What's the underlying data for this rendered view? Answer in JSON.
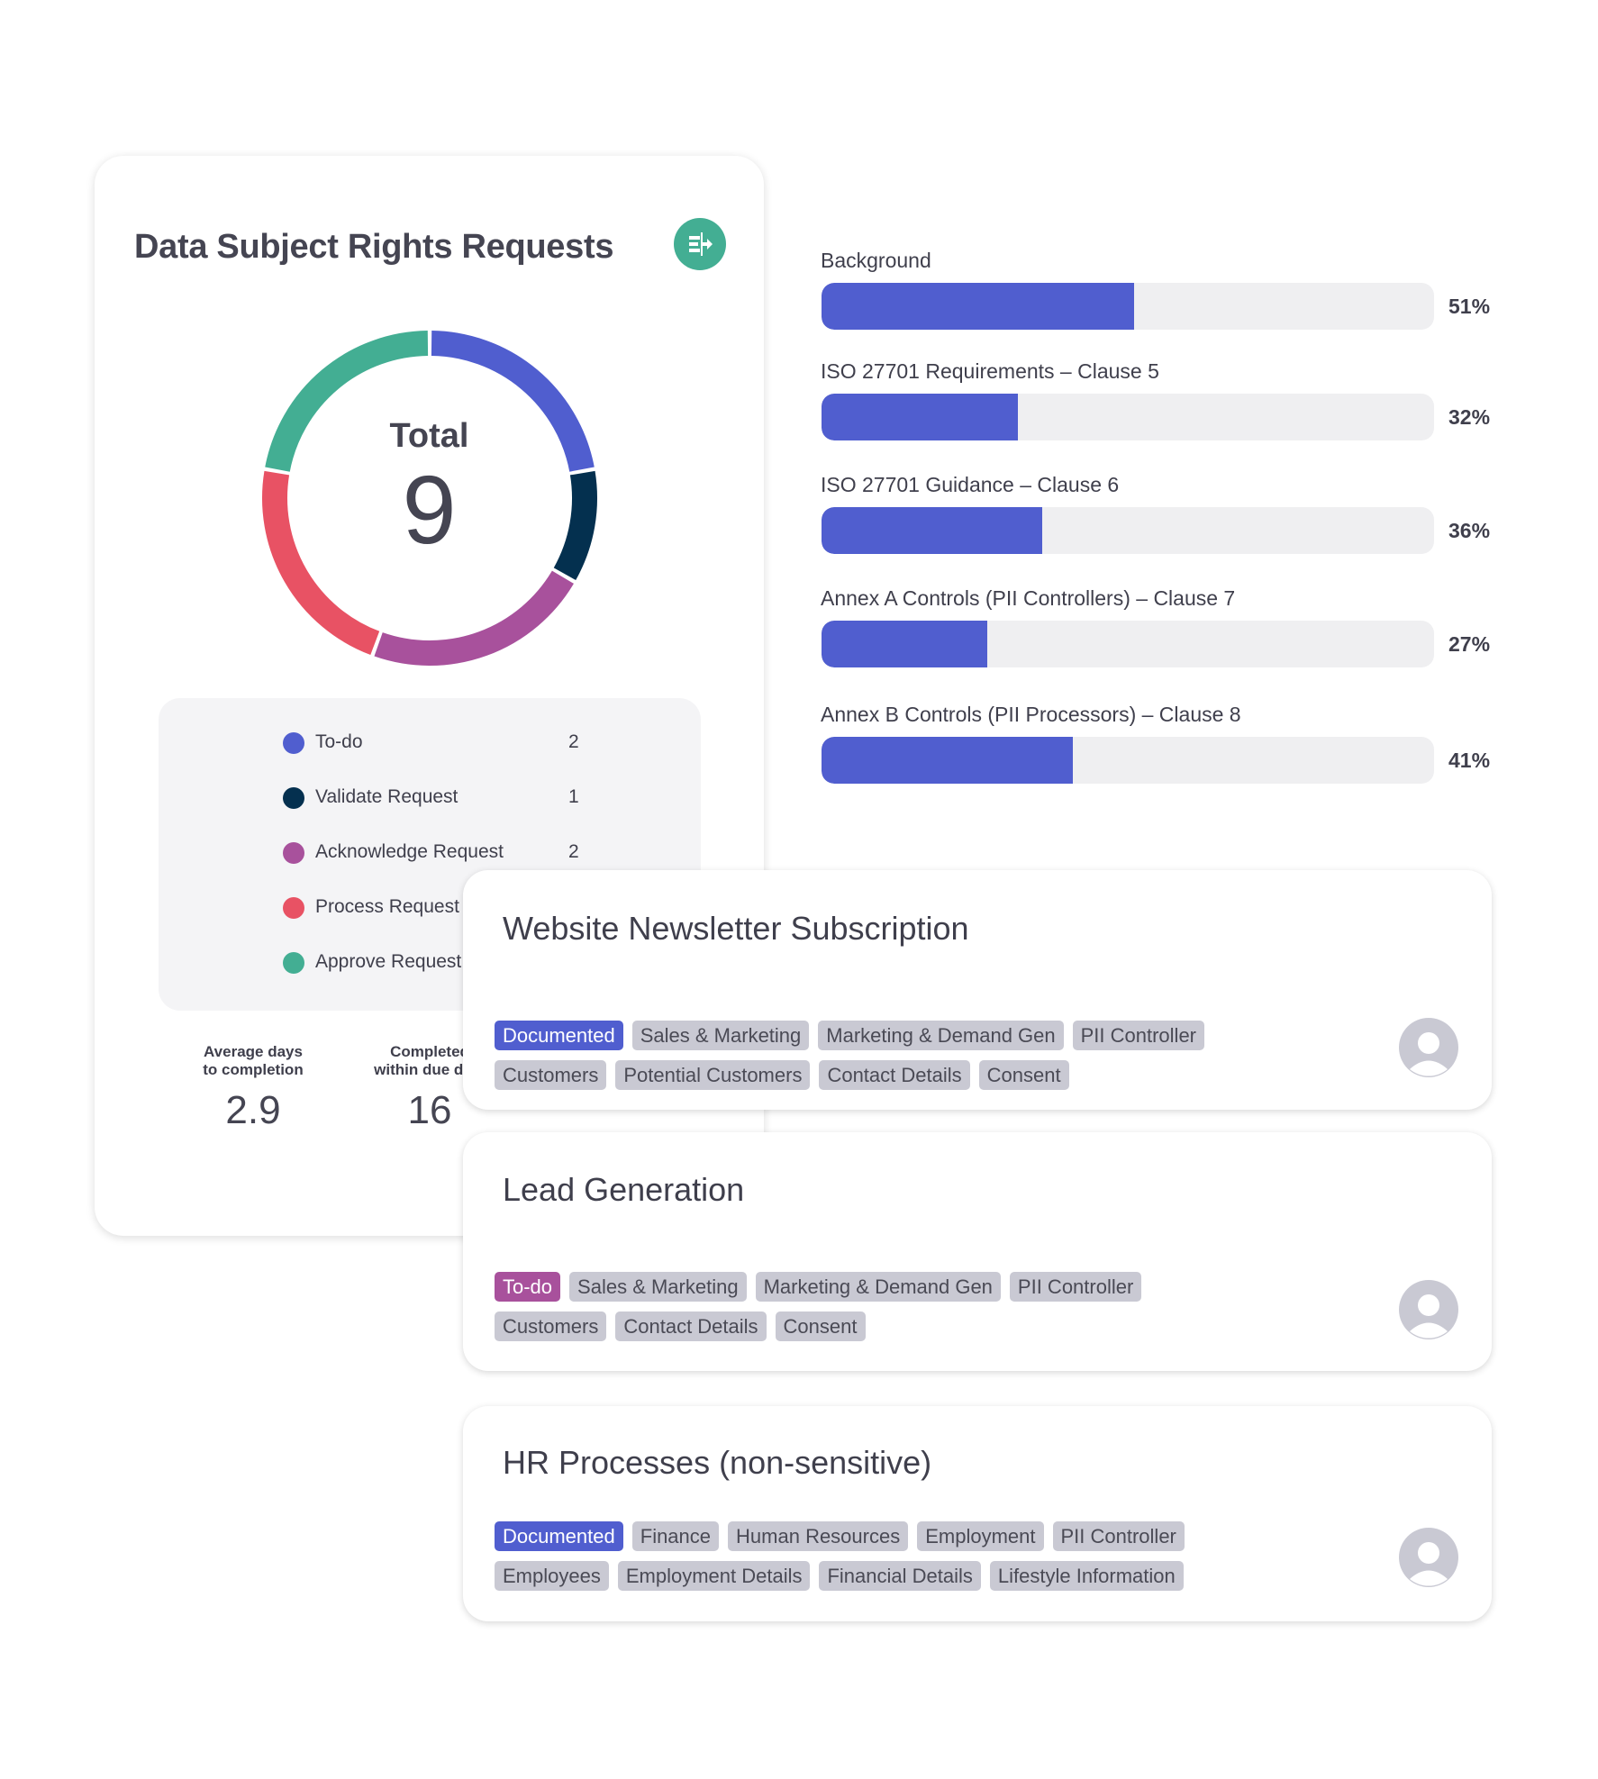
{
  "dsr_card": {
    "title": "Data Subject Rights Requests",
    "action_icon": "export-arrow-icon",
    "total_label": "Total",
    "total_value": "9",
    "legend": [
      {
        "label": "To-do",
        "count": "2",
        "color": "#505ecf"
      },
      {
        "label": "Validate Request",
        "count": "1",
        "color": "#04304f"
      },
      {
        "label": "Acknowledge Request",
        "count": "2",
        "color": "#a8519c"
      },
      {
        "label": "Process Request",
        "count": "2",
        "color": "#e85264"
      },
      {
        "label": "Approve Request",
        "count": "2",
        "color": "#43ae93"
      }
    ],
    "stats": [
      {
        "label_line1": "Average days",
        "label_line2": "to completion",
        "value": "2.9"
      },
      {
        "label_line1": "Completed",
        "label_line2": "within due date",
        "value": "16"
      }
    ]
  },
  "progress": [
    {
      "label": "Background",
      "percent": 51,
      "text": "51%"
    },
    {
      "label": "ISO 27701 Requirements – Clause 5",
      "percent": 32,
      "text": "32%"
    },
    {
      "label": "ISO 27701 Guidance – Clause 6",
      "percent": 36,
      "text": "36%"
    },
    {
      "label": "Annex A Controls (PII Controllers) – Clause 7",
      "percent": 27,
      "text": "27%"
    },
    {
      "label": "Annex B Controls (PII Processors) – Clause 8",
      "percent": 41,
      "text": "41%"
    }
  ],
  "colors": {
    "accent": "#505ecf",
    "todo_tag": "#a8519c",
    "tag_bg": "#c9c9d3",
    "button": "#43ae93"
  },
  "records": [
    {
      "title": "Website Newsletter Subscription",
      "status": "Documented",
      "status_color": "#505ecf",
      "tag_rows": [
        [
          "Sales & Marketing",
          "Marketing & Demand Gen",
          "PII Controller"
        ],
        [
          "Customers",
          "Potential Customers",
          "Contact Details",
          "Consent"
        ]
      ]
    },
    {
      "title": "Lead Generation",
      "status": "To-do",
      "status_color": "#a8519c",
      "tag_rows": [
        [
          "Sales & Marketing",
          "Marketing & Demand Gen",
          "PII Controller"
        ],
        [
          "Customers",
          "Contact Details",
          "Consent"
        ]
      ]
    },
    {
      "title": "HR Processes (non-sensitive)",
      "status": "Documented",
      "status_color": "#505ecf",
      "tag_rows": [
        [
          "Finance",
          "Human Resources",
          "Employment",
          "PII Controller"
        ],
        [
          "Employees",
          "Employment Details",
          "Financial Details",
          "Lifestyle Information"
        ]
      ]
    }
  ]
}
